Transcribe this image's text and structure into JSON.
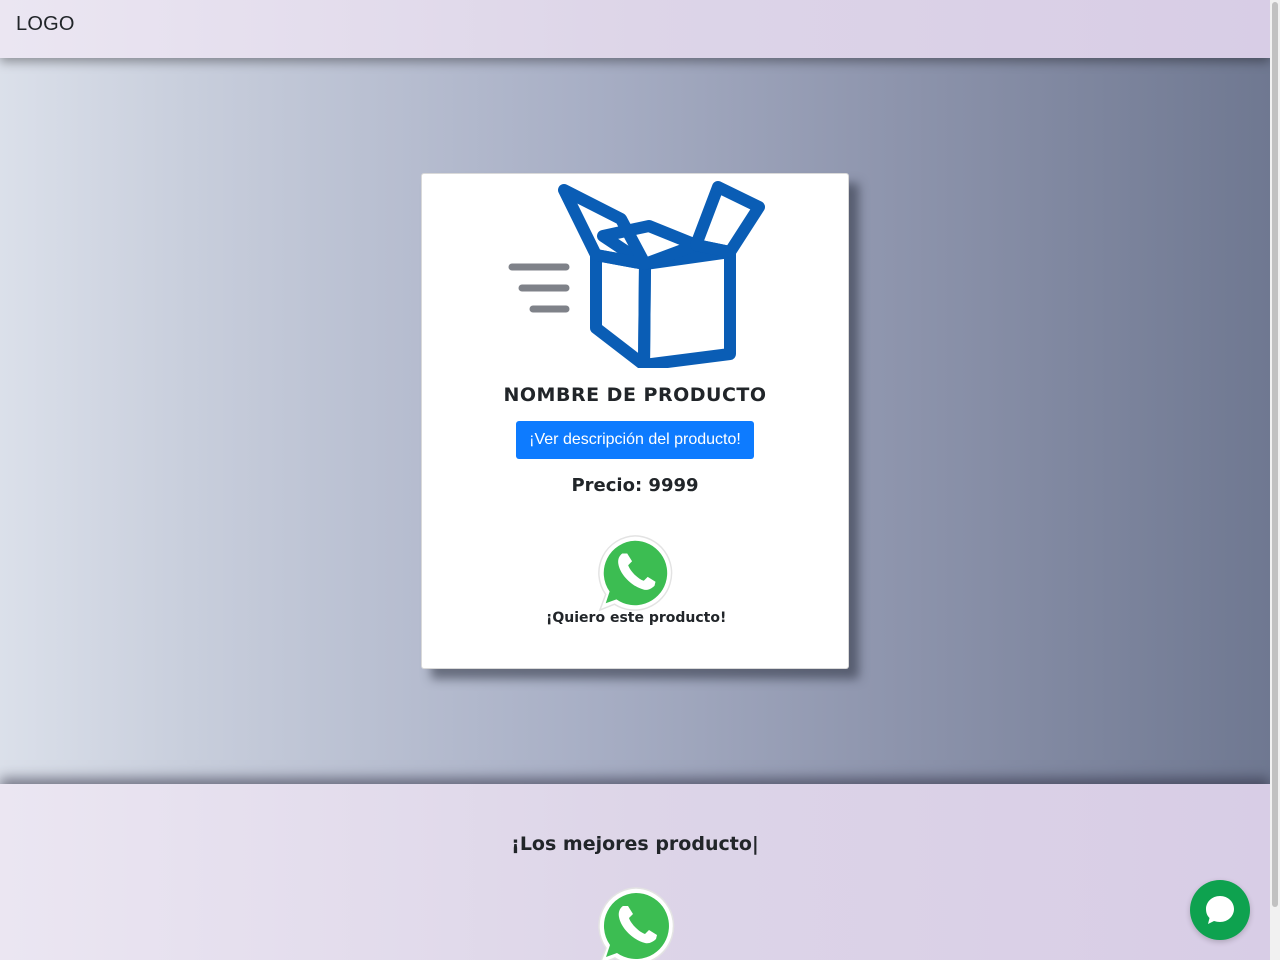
{
  "header": {
    "logo": "LOGO"
  },
  "product": {
    "name": "NOMBRE DE PRODUCTO",
    "description_button": "¡Ver descripción del producto!",
    "price": "Precio: 9999",
    "whatsapp_cta": "¡Quiero este producto!",
    "image_icon": "box-icon"
  },
  "footer": {
    "title": "¡Los mejores producto|",
    "icon": "whatsapp-icon"
  },
  "chat": {
    "icon": "chat-bubble-icon"
  },
  "colors": {
    "accent_button": "#0d7bff",
    "box_icon_blue": "#0a5db5",
    "box_icon_lines": "#7f8289",
    "whatsapp_green": "#25d366",
    "chat_button": "#0ea24f"
  }
}
